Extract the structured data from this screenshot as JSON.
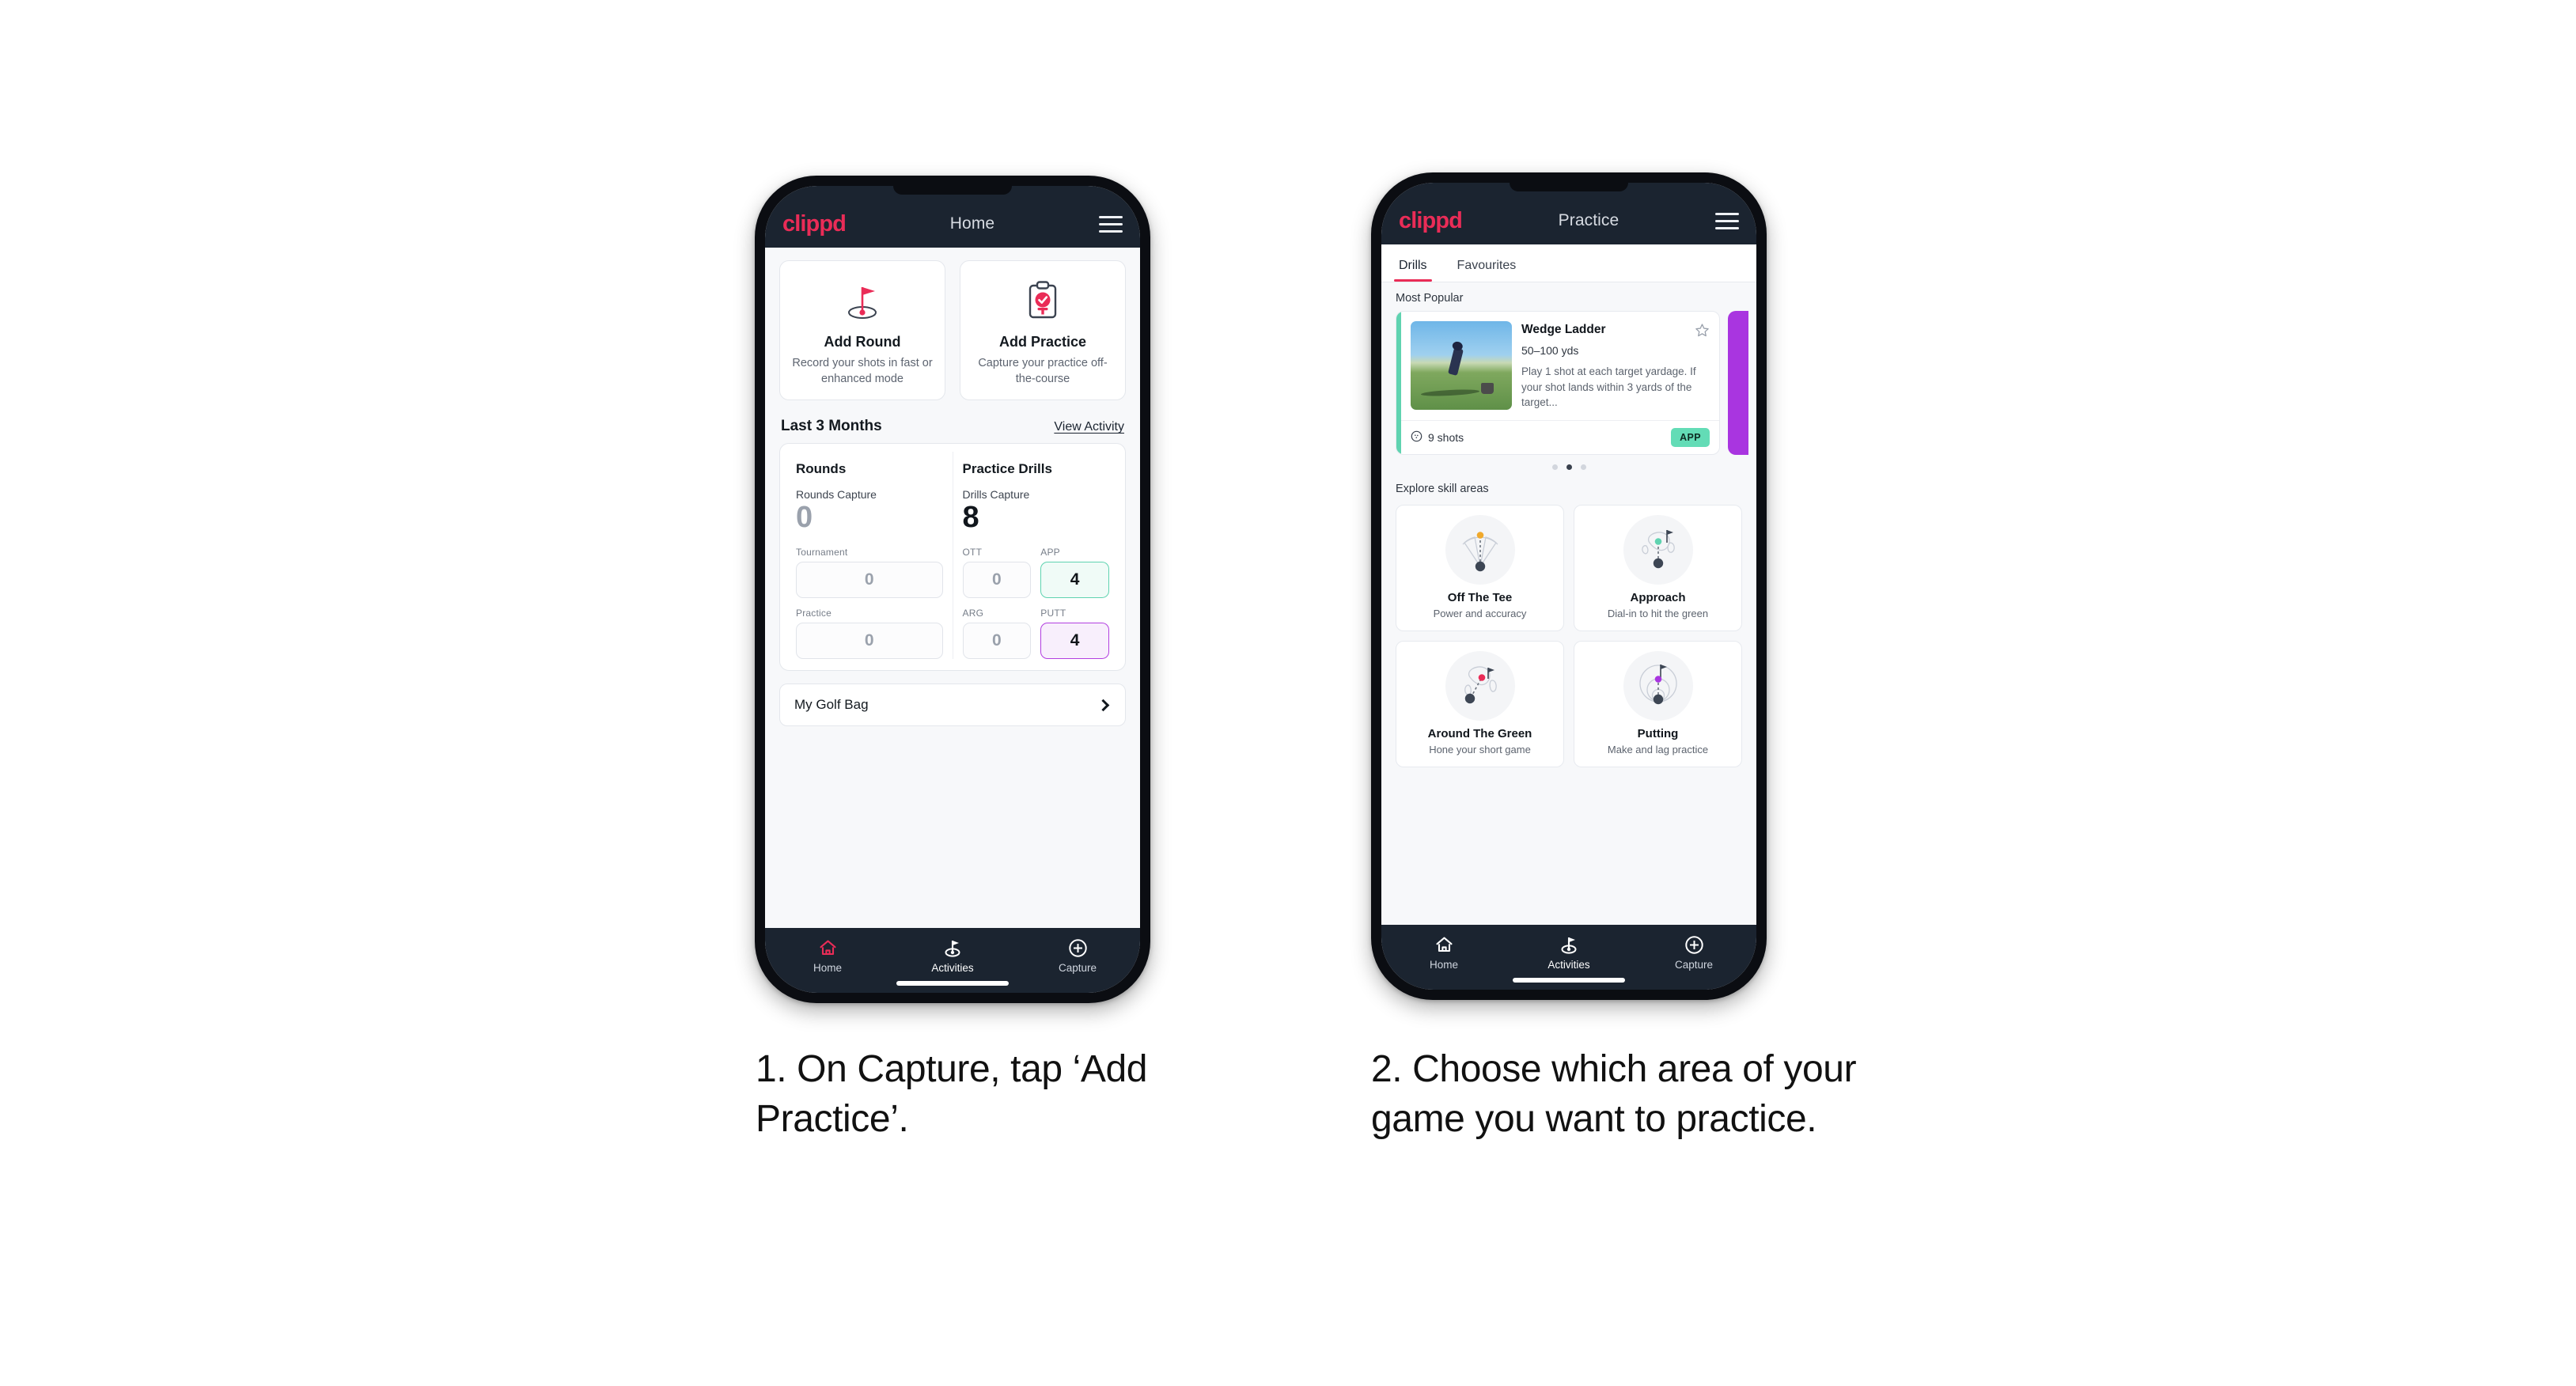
{
  "phone1": {
    "appbar": {
      "brand": "clippd",
      "title": "Home",
      "menu_icon": "hamburger-menu-icon"
    },
    "actions": [
      {
        "icon": "golf-flag-hole-icon",
        "title": "Add Round",
        "subtitle": "Record your shots in fast or enhanced mode"
      },
      {
        "icon": "clipboard-check-icon",
        "title": "Add Practice",
        "subtitle": "Capture your practice off-the-course"
      }
    ],
    "section": {
      "title": "Last 3 Months",
      "link": "View Activity"
    },
    "rounds": {
      "heading": "Rounds",
      "capture_label": "Rounds Capture",
      "capture_value": "0",
      "fields": [
        {
          "label": "Tournament",
          "value": "0",
          "accent": "none"
        },
        {
          "label": "Practice",
          "value": "0",
          "accent": "none"
        }
      ]
    },
    "drills": {
      "heading": "Practice Drills",
      "capture_label": "Drills Capture",
      "capture_value": "8",
      "fields": [
        {
          "label": "OTT",
          "value": "0",
          "accent": "none"
        },
        {
          "label": "APP",
          "value": "4",
          "accent": "teal"
        },
        {
          "label": "ARG",
          "value": "0",
          "accent": "none"
        },
        {
          "label": "PUTT",
          "value": "4",
          "accent": "purple"
        }
      ]
    },
    "bag": {
      "label": "My Golf Bag",
      "chevron": "chevron-right-icon"
    },
    "nav": [
      {
        "icon": "home-icon",
        "label": "Home",
        "active": false,
        "tint": "pink"
      },
      {
        "icon": "golf-flag-icon",
        "label": "Activities",
        "active": true,
        "tint": "white"
      },
      {
        "icon": "plus-circle-icon",
        "label": "Capture",
        "active": false,
        "tint": "white"
      }
    ]
  },
  "phone2": {
    "appbar": {
      "brand": "clippd",
      "title": "Practice",
      "menu_icon": "hamburger-menu-icon"
    },
    "tabs": [
      {
        "label": "Drills",
        "active": true
      },
      {
        "label": "Favourites",
        "active": false
      }
    ],
    "most_popular_label": "Most Popular",
    "drill": {
      "title": "Wedge Ladder",
      "yardage": "50–100 yds",
      "description": "Play 1 shot at each target yardage. If your shot lands within 3 yards of the target...",
      "shots": "9 shots",
      "shots_icon": "golf-ball-icon",
      "badge": "APP",
      "favourite_icon": "star-outline-icon",
      "accent_color": "#5fd3b0",
      "next_card_accent": "#a935e0"
    },
    "carousel_dots": {
      "count": 3,
      "active_index": 1
    },
    "skill_heading": "Explore skill areas",
    "skills": [
      {
        "icon": "tee-shot-dispersion-icon",
        "name": "Off The Tee",
        "sub": "Power and accuracy",
        "dot_color": "#f0a92c"
      },
      {
        "icon": "approach-green-icon",
        "name": "Approach",
        "sub": "Dial-in to hit the green",
        "dot_color": "#5fd3b0"
      },
      {
        "icon": "chip-around-green-icon",
        "name": "Around The Green",
        "sub": "Hone your short game",
        "dot_color": "#ea2c57"
      },
      {
        "icon": "putting-rings-icon",
        "name": "Putting",
        "sub": "Make and lag practice",
        "dot_color": "#a935e0"
      }
    ],
    "nav": [
      {
        "icon": "home-icon",
        "label": "Home",
        "active": false,
        "tint": "white"
      },
      {
        "icon": "golf-flag-icon",
        "label": "Activities",
        "active": true,
        "tint": "white"
      },
      {
        "icon": "plus-circle-icon",
        "label": "Capture",
        "active": false,
        "tint": "white"
      }
    ]
  },
  "captions": {
    "one": "1. On Capture, tap ‘Add Practice’.",
    "two": "2. Choose which area of your game you want to practice."
  },
  "colors": {
    "brand_pink": "#ea2c57",
    "header_dark": "#1b2430",
    "teal": "#5fd3b0",
    "purple": "#a935e0",
    "page_bg": "#ffffff"
  }
}
